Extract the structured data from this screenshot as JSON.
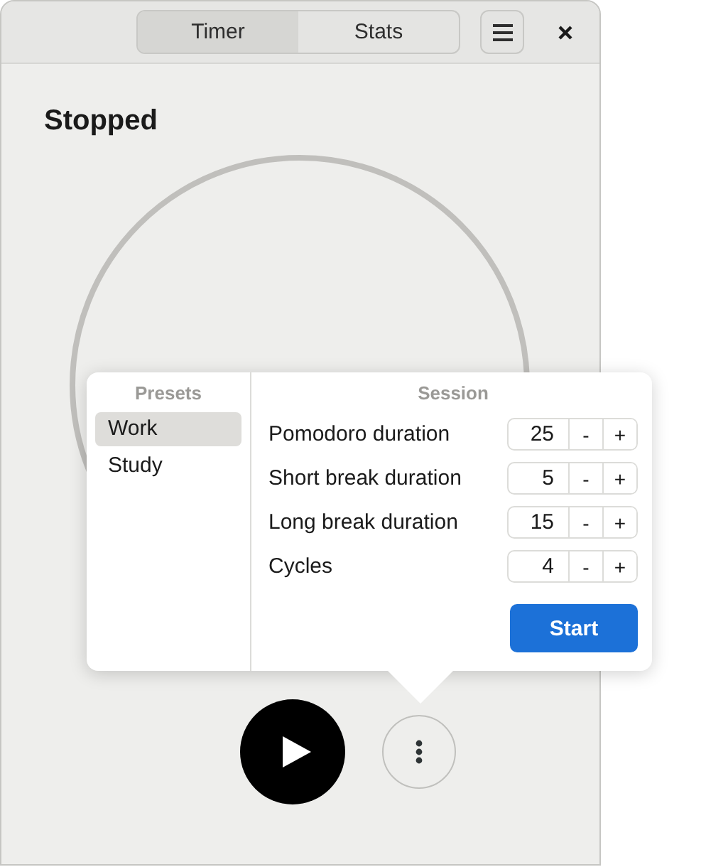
{
  "tabs": [
    {
      "label": "Timer",
      "selected": true
    },
    {
      "label": "Stats",
      "selected": false
    }
  ],
  "status": "Stopped",
  "popover": {
    "presets_heading": "Presets",
    "presets": [
      {
        "label": "Work",
        "selected": true
      },
      {
        "label": "Study",
        "selected": false
      }
    ],
    "session_heading": "Session",
    "settings": [
      {
        "label": "Pomodoro duration",
        "value": "25",
        "decrement": "-",
        "increment": "+"
      },
      {
        "label": "Short break duration",
        "value": "5",
        "decrement": "-",
        "increment": "+"
      },
      {
        "label": "Long break duration",
        "value": "15",
        "decrement": "-",
        "increment": "+"
      },
      {
        "label": "Cycles",
        "value": "4",
        "decrement": "-",
        "increment": "+"
      }
    ],
    "start_button": "Start"
  }
}
